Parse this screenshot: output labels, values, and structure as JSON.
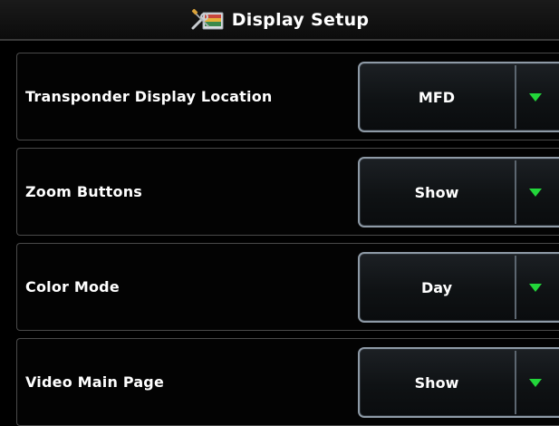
{
  "header": {
    "title": "Display Setup",
    "icon": "settings-tools-icon"
  },
  "colors": {
    "background": "#000000",
    "text": "#ffffff",
    "dropdown_border": "#8e9aa6",
    "arrow": "#22d63a"
  },
  "settings": [
    {
      "label": "Transponder Display Location",
      "value": "MFD"
    },
    {
      "label": "Zoom Buttons",
      "value": "Show"
    },
    {
      "label": "Color Mode",
      "value": "Day"
    },
    {
      "label": "Video Main Page",
      "value": "Show"
    }
  ]
}
